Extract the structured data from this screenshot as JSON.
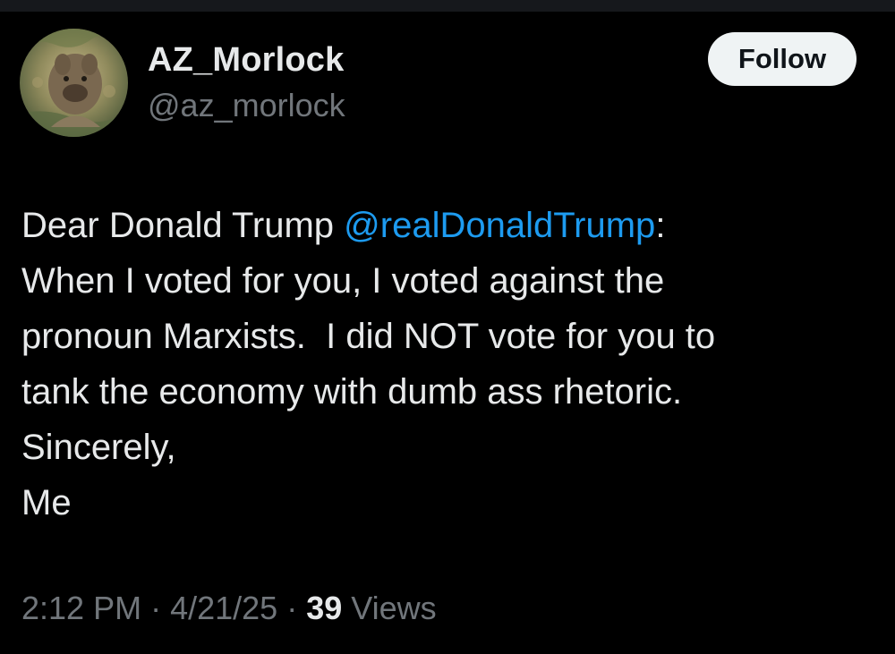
{
  "user": {
    "display_name": "AZ_Morlock",
    "handle": "@az_morlock"
  },
  "follow_button": {
    "label": "Follow"
  },
  "tweet": {
    "line1_prefix": "Dear Donald Trump ",
    "mention": "@realDonaldTrump",
    "line1_suffix": ":",
    "line2": "When I voted for you, I voted against the",
    "line3": "pronoun Marxists.  I did NOT vote for you to",
    "line4": "tank the economy with dumb ass rhetoric.",
    "line5": "Sincerely,",
    "line6": "Me"
  },
  "meta": {
    "time": "2:12 PM",
    "separator": " · ",
    "date": "4/21/25",
    "views_count": "39",
    "views_label": " Views"
  },
  "colors": {
    "background": "#000000",
    "text_primary": "#e7e9ea",
    "text_secondary": "#71767b",
    "link": "#1d9bf0",
    "button_bg": "#eff3f4"
  },
  "icons": {
    "avatar": "profile-avatar"
  }
}
